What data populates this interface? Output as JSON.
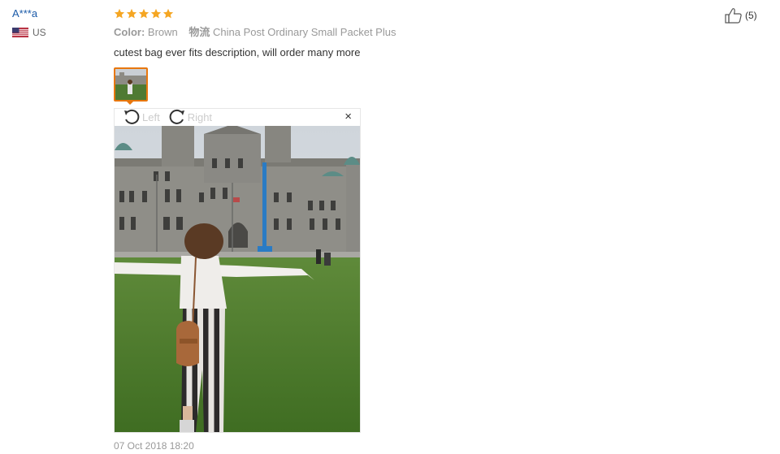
{
  "buyer": {
    "name": "A***a",
    "country": "US",
    "flag_icon": "us-flag-icon"
  },
  "review": {
    "rating": 5,
    "star_color": "#f5a623",
    "attributes": [
      {
        "key": "Color:",
        "value": "Brown"
      },
      {
        "key": "物流",
        "value": "China Post Ordinary Small Packet Plus"
      }
    ],
    "text": "cutest bag ever fits description, will order many more",
    "timestamp": "07 Oct 2018 18:20"
  },
  "viewer": {
    "rotate_left_label": "Left",
    "rotate_right_label": "Right",
    "close_label": "×",
    "accent_color": "#e8770e"
  },
  "helpful": {
    "icon": "thumbs-up-icon",
    "count": "(5)"
  }
}
